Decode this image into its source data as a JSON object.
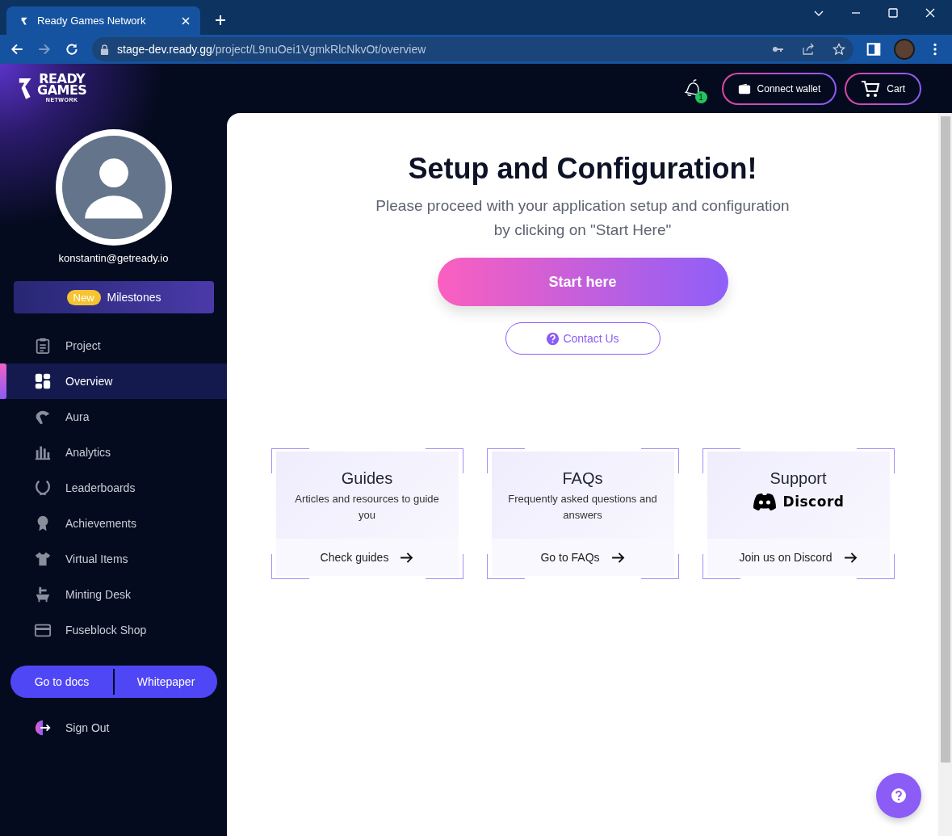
{
  "browser": {
    "tab_title": "Ready Games Network",
    "url_host": "stage-dev.ready.gg",
    "url_path": "/project/L9nuOei1VgmkRlcNkvOt/overview"
  },
  "header": {
    "notification_count": "1",
    "connect_wallet": "Connect wallet",
    "cart": "Cart"
  },
  "sidebar": {
    "logo": [
      "READY",
      "GAMES",
      "NETWORK"
    ],
    "email": "konstantin@getready.io",
    "milestones": {
      "badge": "New",
      "label": "Milestones"
    },
    "items": [
      {
        "label": "Project",
        "selected": false
      },
      {
        "label": "Overview",
        "selected": true
      },
      {
        "label": "Aura",
        "selected": false
      },
      {
        "label": "Analytics",
        "selected": false
      },
      {
        "label": "Leaderboards",
        "selected": false
      },
      {
        "label": "Achievements",
        "selected": false
      },
      {
        "label": "Virtual Items",
        "selected": false
      },
      {
        "label": "Minting Desk",
        "selected": false
      },
      {
        "label": "Fuseblock Shop",
        "selected": false
      }
    ],
    "docs_buttons": [
      "Go to docs",
      "Whitepaper"
    ],
    "sign_out": "Sign Out"
  },
  "main": {
    "title": "Setup and Configuration!",
    "subtitle_lines": [
      "Please proceed with your application setup and configuration",
      "by clicking on \"Start Here\""
    ],
    "start_button": "Start here",
    "contact_button": "Contact Us",
    "cards": [
      {
        "kind": "text",
        "title": "Guides",
        "description": "Articles and resources to guide you",
        "action": "Check guides"
      },
      {
        "kind": "text",
        "title": "FAQs",
        "description": "Frequently asked questions and answers",
        "action": "Go to FAQs"
      },
      {
        "kind": "discord",
        "title": "Support",
        "brand": "Discord",
        "action": "Join us on Discord"
      }
    ]
  }
}
